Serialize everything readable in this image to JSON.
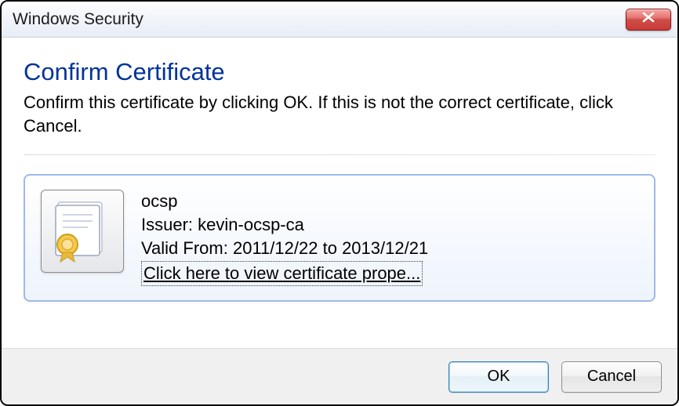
{
  "window": {
    "title": "Windows Security"
  },
  "dialog": {
    "heading": "Confirm Certificate",
    "instruction": "Confirm this certificate by clicking OK. If this is not the correct certificate, click Cancel."
  },
  "certificate": {
    "name": "ocsp",
    "issuer_label": "Issuer:",
    "issuer": "kevin-ocsp-ca",
    "valid_label": "Valid From:",
    "valid_from": "2011/12/22",
    "valid_to": "2013/12/21",
    "valid_sep": "to",
    "view_link": "Click here to view certificate prope..."
  },
  "buttons": {
    "ok": "OK",
    "cancel": "Cancel"
  }
}
